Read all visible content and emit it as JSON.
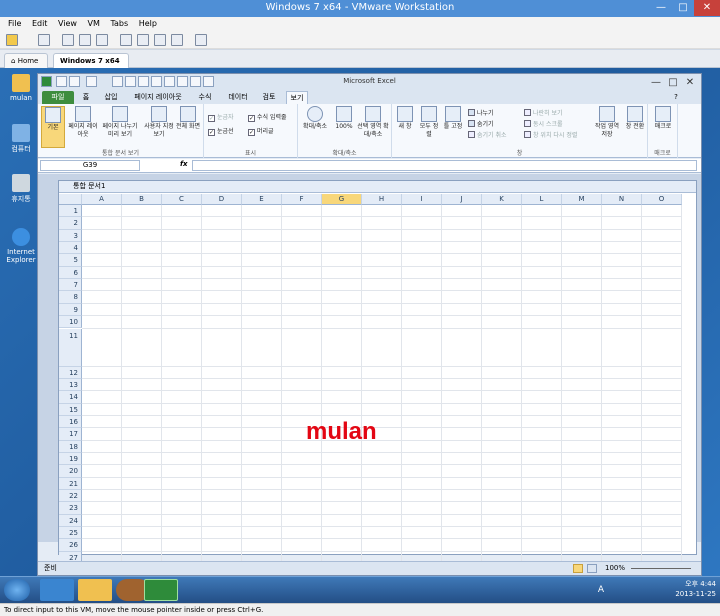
{
  "vmware": {
    "title": "Windows 7 x64 - VMware Workstation",
    "menu": [
      "File",
      "Edit",
      "View",
      "VM",
      "Tabs",
      "Help"
    ],
    "tabs": [
      {
        "label": "Home"
      },
      {
        "label": "Windows 7 x64",
        "active": true
      }
    ],
    "hint": "To direct input to this VM, move the mouse pointer inside or press Ctrl+G."
  },
  "desktop": {
    "icons": [
      {
        "label": "mulan",
        "icon": "user-folder-icon"
      },
      {
        "label": "컴퓨터",
        "icon": "computer-icon"
      },
      {
        "label": "휴지통",
        "icon": "recycle-bin-icon"
      },
      {
        "label": "Internet Explorer",
        "icon": "internet-explorer-icon"
      }
    ]
  },
  "excel": {
    "title": "Microsoft Excel",
    "ribbon_tabs": [
      "파일",
      "홈",
      "삽입",
      "페이지 레이아웃",
      "수식",
      "데이터",
      "검토",
      "보기"
    ],
    "active_tab": "보기",
    "groups": {
      "views": {
        "label": "통합 문서 보기",
        "buttons": [
          "기본",
          "페이지 레이아웃",
          "페이지 나누기 미리 보기",
          "사용자 지정 보기",
          "전체 화면"
        ]
      },
      "show": {
        "label": "표시",
        "checks": [
          {
            "label": "눈금자",
            "checked": true,
            "disabled": true
          },
          {
            "label": "수식 입력줄",
            "checked": true
          },
          {
            "label": "눈금선",
            "checked": true
          },
          {
            "label": "머리글",
            "checked": true
          }
        ]
      },
      "zoom": {
        "label": "확대/축소",
        "buttons": [
          "확대/축소",
          "100%",
          "선택 영역 확대/축소"
        ]
      },
      "window": {
        "label": "창",
        "buttons": [
          "새 창",
          "모두 정렬",
          "틀 고정"
        ],
        "small_left": [
          "나누기",
          "숨기기",
          "숨기기 취소"
        ],
        "small_right": [
          "나란히 보기",
          "동시 스크롤",
          "창 위치 다시 정렬"
        ],
        "buttons2": [
          "작업 영역 저장",
          "창 전환"
        ]
      },
      "macro": {
        "label": "매크로",
        "buttons": [
          "매크로"
        ]
      }
    },
    "name_box": "G39",
    "fx": "fx",
    "workbook_title": "통합 문서1",
    "columns": [
      "A",
      "B",
      "C",
      "D",
      "E",
      "F",
      "G",
      "H",
      "I",
      "J",
      "K",
      "L",
      "M",
      "N",
      "O"
    ],
    "rows": [
      "1",
      "2",
      "3",
      "4",
      "5",
      "6",
      "7",
      "8",
      "9",
      "10",
      "11",
      "12",
      "13",
      "14",
      "15",
      "16",
      "17",
      "18",
      "19",
      "20",
      "21",
      "22",
      "23",
      "24",
      "25",
      "26",
      "27"
    ],
    "selected_column": "G",
    "status": "준비",
    "zoom_level": "100%",
    "overlay_text": "mulan"
  },
  "taskbar": {
    "items": [
      "windows-explorer-icon",
      "internet-explorer-icon",
      "media-player-icon",
      "excel-icon"
    ],
    "lang": "A",
    "time": "오후 4:44",
    "date": "2013-11-25"
  }
}
